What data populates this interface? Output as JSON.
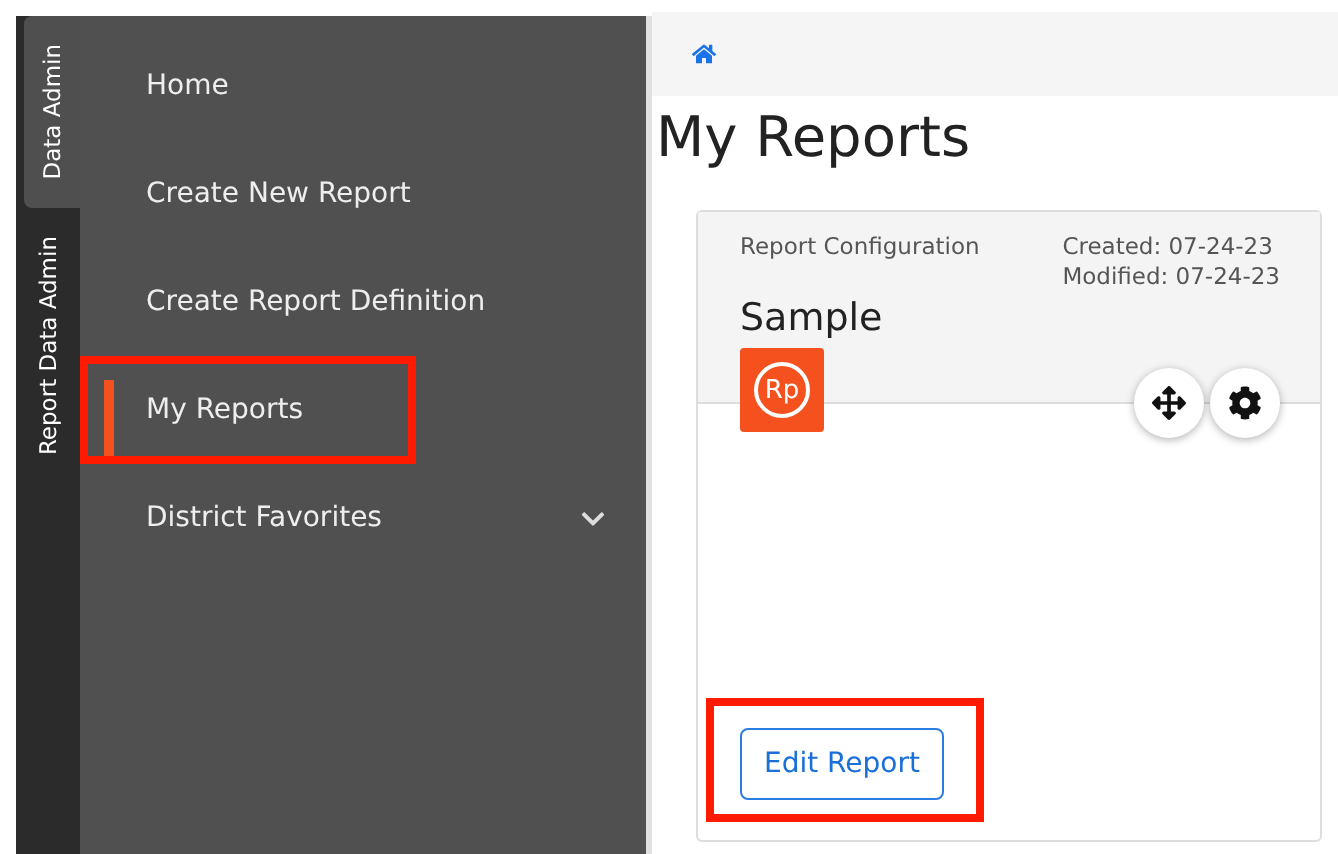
{
  "side_tabs": [
    {
      "label": "Data Admin",
      "selected": true
    },
    {
      "label": "Report Data Admin",
      "selected": false
    }
  ],
  "menu": [
    {
      "label": "Home",
      "selected": false,
      "annotated": false
    },
    {
      "label": "Create New Report",
      "selected": false,
      "annotated": false
    },
    {
      "label": "Create Report Definition",
      "selected": false,
      "annotated": false
    },
    {
      "label": "My Reports",
      "selected": true,
      "annotated": true
    },
    {
      "label": "District Favorites",
      "selected": false,
      "annotated": false,
      "expanded": false
    }
  ],
  "page": {
    "title": "My Reports"
  },
  "card": {
    "category": "Report Configuration",
    "created": "Created: 07-24-23",
    "modified": "Modified: 07-24-23",
    "name": "Sample",
    "logo": "Rp",
    "button": {
      "label": "Edit Report",
      "annotated": true
    }
  }
}
